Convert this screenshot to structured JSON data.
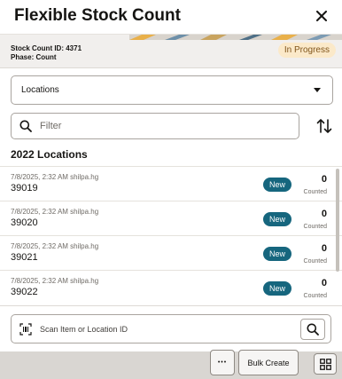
{
  "header": {
    "title": "Flexible Stock Count",
    "close_icon": "close-icon"
  },
  "banner": {
    "stock_count_id": "Stock Count ID: 4371",
    "phase": "Phase: Count",
    "status": "In Progress"
  },
  "location_select": {
    "value": "Locations",
    "icon": "chevron-down-icon"
  },
  "filter": {
    "placeholder": "Filter",
    "icon": "search-icon",
    "sort_icon": "sort-icon"
  },
  "section": {
    "title": "2022 Locations"
  },
  "rows": [
    {
      "meta": "7/8/2025, 2:32 AM shilpa.hg",
      "id": "39019",
      "status": "New",
      "count": "0",
      "count_label": "Counted"
    },
    {
      "meta": "7/8/2025, 2:32 AM shilpa.hg",
      "id": "39020",
      "status": "New",
      "count": "0",
      "count_label": "Counted"
    },
    {
      "meta": "7/8/2025, 2:32 AM shilpa.hg",
      "id": "39021",
      "status": "New",
      "count": "0",
      "count_label": "Counted"
    },
    {
      "meta": "7/8/2025, 2:32 AM shilpa.hg",
      "id": "39022",
      "status": "New",
      "count": "0",
      "count_label": "Counted"
    }
  ],
  "scan": {
    "placeholder": "Scan Item or Location ID",
    "icon": "barcode-scan-icon",
    "button_icon": "search-icon"
  },
  "footer": {
    "more_label": "•••",
    "bulk_create_label": "Bulk Create",
    "grid_icon": "grid-icon"
  },
  "colors": {
    "accent": "#16667e",
    "badge_bg": "#fbe9c9",
    "badge_text": "#80551b",
    "footer_bg": "#d9d6d2"
  }
}
